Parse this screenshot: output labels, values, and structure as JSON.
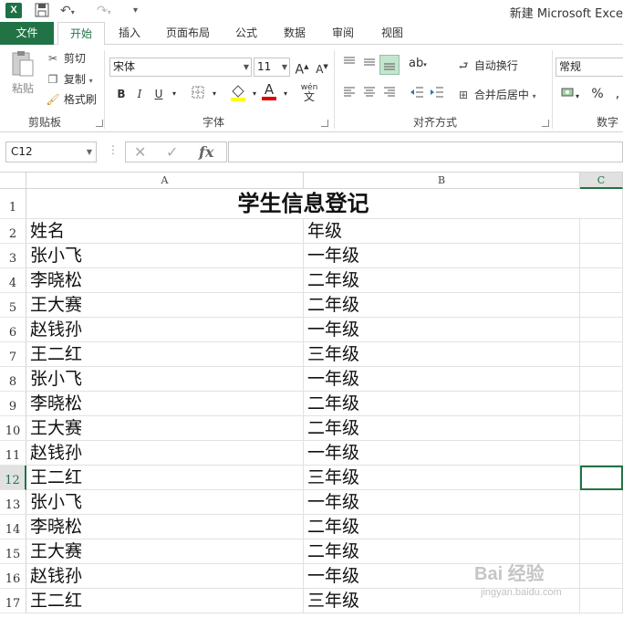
{
  "window": {
    "title": "新建 Microsoft Exce",
    "app_icon": "excel-icon"
  },
  "quick_access": {
    "save": "save-icon",
    "undo": "undo-icon",
    "redo": "redo-icon",
    "customize": "more-icon"
  },
  "tabs": [
    {
      "label": "文件"
    },
    {
      "label": "开始"
    },
    {
      "label": "插入"
    },
    {
      "label": "页面布局"
    },
    {
      "label": "公式"
    },
    {
      "label": "数据"
    },
    {
      "label": "审阅"
    },
    {
      "label": "视图"
    }
  ],
  "ribbon": {
    "clipboard": {
      "paste": "粘贴",
      "cut": "剪切",
      "copy": "复制",
      "format_painter": "格式刷",
      "group": "剪贴板"
    },
    "font": {
      "font_name": "宋体",
      "font_size": "11",
      "group": "字体",
      "bold": "B",
      "italic": "I",
      "underline": "U",
      "phonetic": "wén"
    },
    "alignment": {
      "wrap_text": "自动换行",
      "merge_center": "合并后居中",
      "group": "对齐方式"
    },
    "number": {
      "format": "常规",
      "group": "数字",
      "percent": "%"
    }
  },
  "formula_bar": {
    "name_box": "C12",
    "cancel": "✕",
    "enter": "✓",
    "fx": "fx",
    "value": ""
  },
  "sheet": {
    "columns": [
      "A",
      "B",
      "C"
    ],
    "row_numbers": [
      "1",
      "2",
      "3",
      "4",
      "5",
      "6",
      "7",
      "8",
      "9",
      "10",
      "11",
      "12",
      "13",
      "14",
      "15",
      "16",
      "17"
    ],
    "title": "学生信息登记",
    "headers": [
      "姓名",
      "年级"
    ],
    "rows": [
      [
        "张小飞",
        "一年级"
      ],
      [
        "李晓松",
        "二年级"
      ],
      [
        "王大赛",
        "二年级"
      ],
      [
        "赵钱孙",
        "一年级"
      ],
      [
        "王二红",
        "三年级"
      ],
      [
        "张小飞",
        "一年级"
      ],
      [
        "李晓松",
        "二年级"
      ],
      [
        "王大赛",
        "二年级"
      ],
      [
        "赵钱孙",
        "一年级"
      ],
      [
        "王二红",
        "三年级"
      ],
      [
        "张小飞",
        "一年级"
      ],
      [
        "李晓松",
        "二年级"
      ],
      [
        "王大赛",
        "二年级"
      ],
      [
        "赵钱孙",
        "一年级"
      ],
      [
        "王二红",
        "三年级"
      ]
    ]
  },
  "watermark": {
    "text": "Bai 经验",
    "sub": "jingyan.baidu.com"
  }
}
